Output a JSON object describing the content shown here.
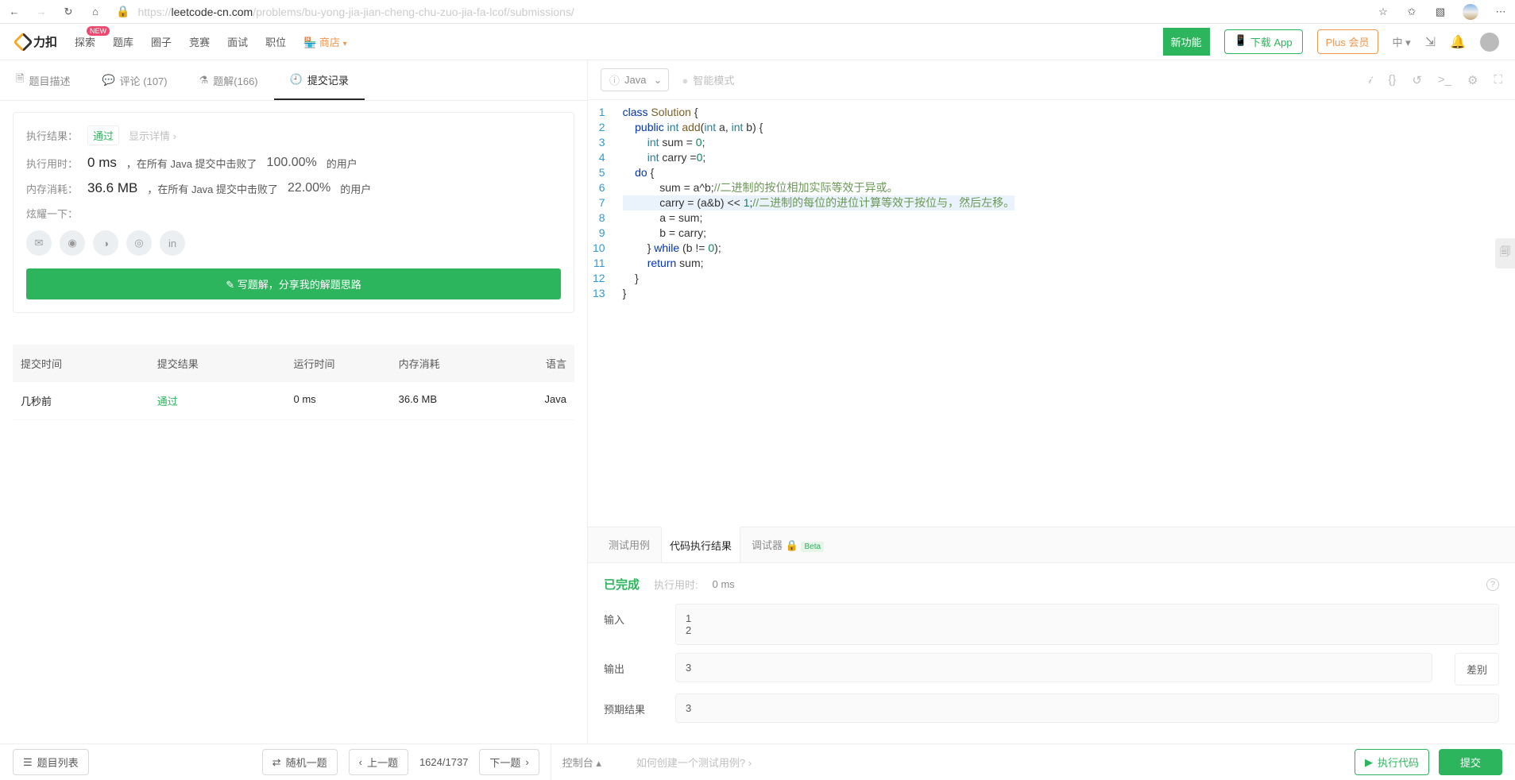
{
  "browser": {
    "url_prefix": "https://",
    "url_host": "leetcode-cn.com",
    "url_path": "/problems/bu-yong-jia-jian-cheng-chu-zuo-jia-fa-lcof/submissions/"
  },
  "nav": {
    "logo": "力扣",
    "items": [
      "探索",
      "题库",
      "圈子",
      "竞赛",
      "面试",
      "职位"
    ],
    "shop": "商店",
    "new_badge": "NEW",
    "new_feature": "新功能",
    "app_btn": "下载 App",
    "plus_btn": "Plus 会员",
    "lang": "中"
  },
  "tabs": {
    "desc": "题目描述",
    "comment": "评论 (107)",
    "solution": "题解(166)",
    "submit": "提交记录"
  },
  "result": {
    "exec_label": "执行结果：",
    "status": "通过",
    "detail": "显示详情 ›",
    "time_label": "执行用时：",
    "time_val": "0 ms",
    "time_text": "，在所有 Java 提交中击败了",
    "time_pct": "100.00%",
    "time_suffix": "的用户",
    "mem_label": "内存消耗：",
    "mem_val": "36.6 MB",
    "mem_text": "，在所有 Java 提交中击败了",
    "mem_pct": "22.00%",
    "mem_suffix": "的用户",
    "brag": "炫耀一下：",
    "write_btn": "✎ 写题解，分享我的解题思路"
  },
  "subtable": {
    "h1": "提交时间",
    "h2": "提交结果",
    "h3": "运行时间",
    "h4": "内存消耗",
    "h5": "语言",
    "r1": "几秒前",
    "r2": "通过",
    "r3": "0 ms",
    "r4": "36.6 MB",
    "r5": "Java"
  },
  "codebar": {
    "language": "Java",
    "smart": "智能模式"
  },
  "code_lines": [
    {
      "n": "1",
      "html": "<span class='kw'>class</span> <span class='cl'>Solution</span> {"
    },
    {
      "n": "2",
      "html": "    <span class='kw'>public</span> <span class='ty'>int</span> <span class='cl'>add</span>(<span class='ty'>int</span> a, <span class='ty'>int</span> b) {"
    },
    {
      "n": "3",
      "html": "        <span class='ty'>int</span> sum = <span class='nm'>0</span>;"
    },
    {
      "n": "4",
      "html": "        <span class='ty'>int</span> carry =<span class='nm'>0</span>;"
    },
    {
      "n": "5",
      "html": "    <span class='kw'>do</span> {"
    },
    {
      "n": "6",
      "html": "            sum = a^b;<span class='cm'>//二进制的按位相加实际等效于异或。</span>"
    },
    {
      "n": "7",
      "hl": true,
      "html": "            carry = (a&amp;b) &lt;&lt; <span class='nm'>1</span>;<span class='cm'>//二进制的每位的进位计算等效于按位与，然后左移。</span>"
    },
    {
      "n": "8",
      "html": "            a = sum;"
    },
    {
      "n": "9",
      "html": "            b = carry;"
    },
    {
      "n": "10",
      "html": "        } <span class='kw'>while</span> (b != <span class='nm'>0</span>);"
    },
    {
      "n": "11",
      "html": "        <span class='kw'>return</span> sum;"
    },
    {
      "n": "12",
      "html": "    }"
    },
    {
      "n": "13",
      "html": "}"
    }
  ],
  "console_tabs": {
    "test": "测试用例",
    "result": "代码执行结果",
    "debug": "调试器",
    "beta": "Beta"
  },
  "console": {
    "done": "已完成",
    "time_lbl": "执行用时:",
    "time_val": "0 ms",
    "input_lbl": "输入",
    "input_val": "1\n2",
    "output_lbl": "输出",
    "output_val": "3",
    "expect_lbl": "预期结果",
    "expect_val": "3",
    "diff": "差别"
  },
  "footer": {
    "list": "题目列表",
    "random": "随机一题",
    "prev": "上一题",
    "page": "1624/1737",
    "next": "下一题",
    "console": "控制台",
    "hint": "如何创建一个测试用例? ›",
    "run": "执行代码",
    "submit": "提交"
  }
}
